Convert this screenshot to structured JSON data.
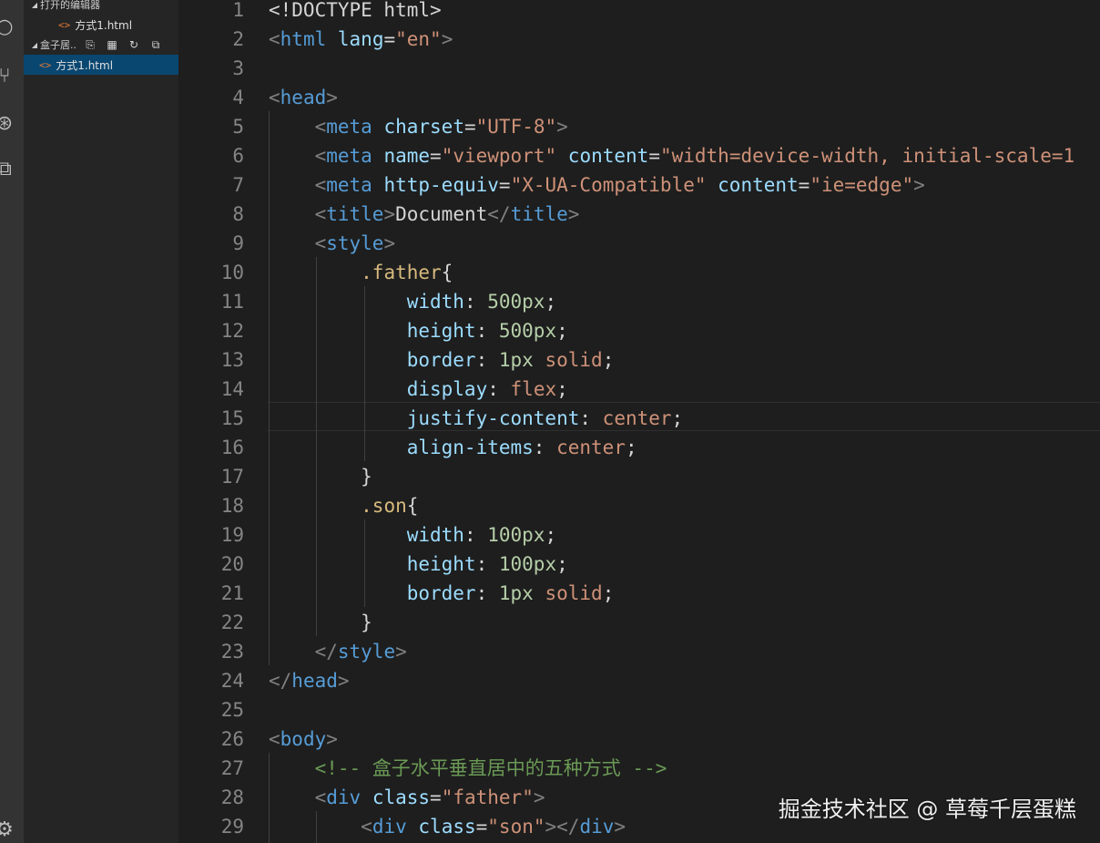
{
  "sidebar": {
    "open_editors_label": "打开的编辑器",
    "open_editor_file": "方式1.html",
    "folder_label": "盒子居..",
    "explorer_file": "方式1.html",
    "file_icon_glyph": "<>"
  },
  "editor": {
    "lines": [
      {
        "n": "1",
        "tokens": [
          {
            "t": "<!DOCTYPE html>",
            "c": "text"
          }
        ]
      },
      {
        "n": "2",
        "tokens": [
          {
            "t": "<",
            "c": "punc"
          },
          {
            "t": "html",
            "c": "tag"
          },
          {
            "t": " ",
            "c": "text"
          },
          {
            "t": "lang",
            "c": "attr"
          },
          {
            "t": "=",
            "c": "text"
          },
          {
            "t": "\"en\"",
            "c": "str"
          },
          {
            "t": ">",
            "c": "punc"
          }
        ]
      },
      {
        "n": "3",
        "tokens": []
      },
      {
        "n": "4",
        "tokens": [
          {
            "t": "<",
            "c": "punc"
          },
          {
            "t": "head",
            "c": "tag"
          },
          {
            "t": ">",
            "c": "punc"
          }
        ]
      },
      {
        "n": "5",
        "tokens": [
          {
            "t": "    ",
            "c": "text"
          },
          {
            "t": "<",
            "c": "punc"
          },
          {
            "t": "meta",
            "c": "tag"
          },
          {
            "t": " ",
            "c": "text"
          },
          {
            "t": "charset",
            "c": "attr"
          },
          {
            "t": "=",
            "c": "text"
          },
          {
            "t": "\"UTF-8\"",
            "c": "str"
          },
          {
            "t": ">",
            "c": "punc"
          }
        ]
      },
      {
        "n": "6",
        "tokens": [
          {
            "t": "    ",
            "c": "text"
          },
          {
            "t": "<",
            "c": "punc"
          },
          {
            "t": "meta",
            "c": "tag"
          },
          {
            "t": " ",
            "c": "text"
          },
          {
            "t": "name",
            "c": "attr"
          },
          {
            "t": "=",
            "c": "text"
          },
          {
            "t": "\"viewport\"",
            "c": "str"
          },
          {
            "t": " ",
            "c": "text"
          },
          {
            "t": "content",
            "c": "attr"
          },
          {
            "t": "=",
            "c": "text"
          },
          {
            "t": "\"width=device-width, initial-scale=1",
            "c": "str"
          }
        ]
      },
      {
        "n": "7",
        "tokens": [
          {
            "t": "    ",
            "c": "text"
          },
          {
            "t": "<",
            "c": "punc"
          },
          {
            "t": "meta",
            "c": "tag"
          },
          {
            "t": " ",
            "c": "text"
          },
          {
            "t": "http-equiv",
            "c": "attr"
          },
          {
            "t": "=",
            "c": "text"
          },
          {
            "t": "\"X-UA-Compatible\"",
            "c": "str"
          },
          {
            "t": " ",
            "c": "text"
          },
          {
            "t": "content",
            "c": "attr"
          },
          {
            "t": "=",
            "c": "text"
          },
          {
            "t": "\"ie=edge\"",
            "c": "str"
          },
          {
            "t": ">",
            "c": "punc"
          }
        ]
      },
      {
        "n": "8",
        "tokens": [
          {
            "t": "    ",
            "c": "text"
          },
          {
            "t": "<",
            "c": "punc"
          },
          {
            "t": "title",
            "c": "tag"
          },
          {
            "t": ">",
            "c": "punc"
          },
          {
            "t": "Document",
            "c": "text"
          },
          {
            "t": "</",
            "c": "punc"
          },
          {
            "t": "title",
            "c": "tag"
          },
          {
            "t": ">",
            "c": "punc"
          }
        ]
      },
      {
        "n": "9",
        "tokens": [
          {
            "t": "    ",
            "c": "text"
          },
          {
            "t": "<",
            "c": "punc"
          },
          {
            "t": "style",
            "c": "tag"
          },
          {
            "t": ">",
            "c": "punc"
          }
        ]
      },
      {
        "n": "10",
        "tokens": [
          {
            "t": "        ",
            "c": "text"
          },
          {
            "t": ".father",
            "c": "sel"
          },
          {
            "t": "{",
            "c": "text"
          }
        ]
      },
      {
        "n": "11",
        "tokens": [
          {
            "t": "            ",
            "c": "text"
          },
          {
            "t": "width",
            "c": "prop"
          },
          {
            "t": ": ",
            "c": "text"
          },
          {
            "t": "500px",
            "c": "num"
          },
          {
            "t": ";",
            "c": "text"
          }
        ]
      },
      {
        "n": "12",
        "tokens": [
          {
            "t": "            ",
            "c": "text"
          },
          {
            "t": "height",
            "c": "prop"
          },
          {
            "t": ": ",
            "c": "text"
          },
          {
            "t": "500px",
            "c": "num"
          },
          {
            "t": ";",
            "c": "text"
          }
        ]
      },
      {
        "n": "13",
        "tokens": [
          {
            "t": "            ",
            "c": "text"
          },
          {
            "t": "border",
            "c": "prop"
          },
          {
            "t": ": ",
            "c": "text"
          },
          {
            "t": "1px",
            "c": "num"
          },
          {
            "t": " ",
            "c": "text"
          },
          {
            "t": "solid",
            "c": "val"
          },
          {
            "t": ";",
            "c": "text"
          }
        ]
      },
      {
        "n": "14",
        "tokens": [
          {
            "t": "            ",
            "c": "text"
          },
          {
            "t": "display",
            "c": "prop"
          },
          {
            "t": ": ",
            "c": "text"
          },
          {
            "t": "flex",
            "c": "val"
          },
          {
            "t": ";",
            "c": "text"
          }
        ]
      },
      {
        "n": "15",
        "tokens": [
          {
            "t": "            ",
            "c": "text"
          },
          {
            "t": "justify-content",
            "c": "prop"
          },
          {
            "t": ": ",
            "c": "text"
          },
          {
            "t": "center",
            "c": "val"
          },
          {
            "t": ";",
            "c": "text"
          }
        ]
      },
      {
        "n": "16",
        "tokens": [
          {
            "t": "            ",
            "c": "text"
          },
          {
            "t": "align-items",
            "c": "prop"
          },
          {
            "t": ": ",
            "c": "text"
          },
          {
            "t": "center",
            "c": "val"
          },
          {
            "t": ";",
            "c": "text"
          }
        ]
      },
      {
        "n": "17",
        "tokens": [
          {
            "t": "        ",
            "c": "text"
          },
          {
            "t": "}",
            "c": "text"
          }
        ]
      },
      {
        "n": "18",
        "tokens": [
          {
            "t": "        ",
            "c": "text"
          },
          {
            "t": ".son",
            "c": "sel"
          },
          {
            "t": "{",
            "c": "text"
          }
        ]
      },
      {
        "n": "19",
        "tokens": [
          {
            "t": "            ",
            "c": "text"
          },
          {
            "t": "width",
            "c": "prop"
          },
          {
            "t": ": ",
            "c": "text"
          },
          {
            "t": "100px",
            "c": "num"
          },
          {
            "t": ";",
            "c": "text"
          }
        ]
      },
      {
        "n": "20",
        "tokens": [
          {
            "t": "            ",
            "c": "text"
          },
          {
            "t": "height",
            "c": "prop"
          },
          {
            "t": ": ",
            "c": "text"
          },
          {
            "t": "100px",
            "c": "num"
          },
          {
            "t": ";",
            "c": "text"
          }
        ]
      },
      {
        "n": "21",
        "tokens": [
          {
            "t": "            ",
            "c": "text"
          },
          {
            "t": "border",
            "c": "prop"
          },
          {
            "t": ": ",
            "c": "text"
          },
          {
            "t": "1px",
            "c": "num"
          },
          {
            "t": " ",
            "c": "text"
          },
          {
            "t": "solid",
            "c": "val"
          },
          {
            "t": ";",
            "c": "text"
          }
        ]
      },
      {
        "n": "22",
        "tokens": [
          {
            "t": "        ",
            "c": "text"
          },
          {
            "t": "}",
            "c": "text"
          }
        ]
      },
      {
        "n": "23",
        "tokens": [
          {
            "t": "    ",
            "c": "text"
          },
          {
            "t": "</",
            "c": "punc"
          },
          {
            "t": "style",
            "c": "tag"
          },
          {
            "t": ">",
            "c": "punc"
          }
        ]
      },
      {
        "n": "24",
        "tokens": [
          {
            "t": "</",
            "c": "punc"
          },
          {
            "t": "head",
            "c": "tag"
          },
          {
            "t": ">",
            "c": "punc"
          }
        ]
      },
      {
        "n": "25",
        "tokens": []
      },
      {
        "n": "26",
        "tokens": [
          {
            "t": "<",
            "c": "punc"
          },
          {
            "t": "body",
            "c": "tag"
          },
          {
            "t": ">",
            "c": "punc"
          }
        ]
      },
      {
        "n": "27",
        "tokens": [
          {
            "t": "    ",
            "c": "text"
          },
          {
            "t": "<!-- 盒子水平垂直居中的五种方式 -->",
            "c": "comment"
          }
        ]
      },
      {
        "n": "28",
        "tokens": [
          {
            "t": "    ",
            "c": "text"
          },
          {
            "t": "<",
            "c": "punc"
          },
          {
            "t": "div",
            "c": "tag"
          },
          {
            "t": " ",
            "c": "text"
          },
          {
            "t": "class",
            "c": "attr"
          },
          {
            "t": "=",
            "c": "text"
          },
          {
            "t": "\"father\"",
            "c": "str"
          },
          {
            "t": ">",
            "c": "punc"
          }
        ]
      },
      {
        "n": "29",
        "tokens": [
          {
            "t": "        ",
            "c": "text"
          },
          {
            "t": "<",
            "c": "punc"
          },
          {
            "t": "div",
            "c": "tag"
          },
          {
            "t": " ",
            "c": "text"
          },
          {
            "t": "class",
            "c": "attr"
          },
          {
            "t": "=",
            "c": "text"
          },
          {
            "t": "\"son\"",
            "c": "str"
          },
          {
            "t": "></",
            "c": "punc"
          },
          {
            "t": "div",
            "c": "tag"
          },
          {
            "t": ">",
            "c": "punc"
          }
        ]
      }
    ]
  },
  "watermark": "掘金技术社区 @ 草莓千层蛋糕"
}
